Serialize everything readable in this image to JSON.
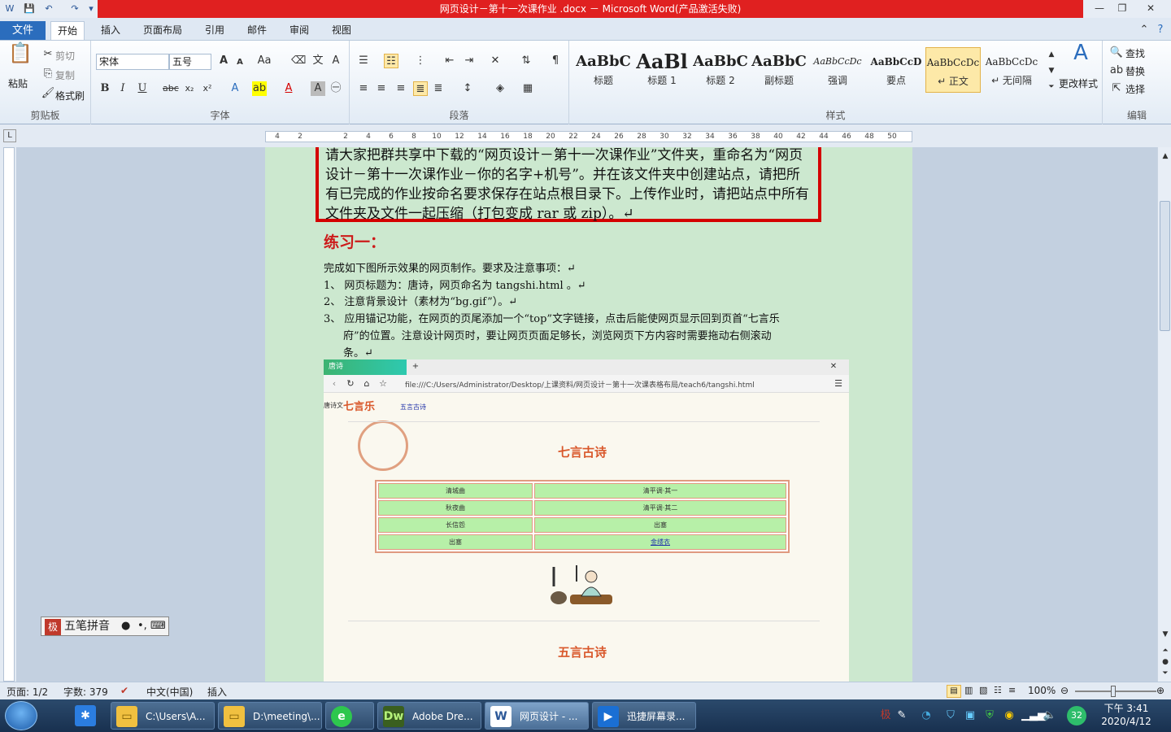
{
  "window": {
    "title": "网页设计－第十一次课作业 .docx － Microsoft Word(产品激活失败)"
  },
  "tabs": {
    "file": "文件",
    "items": [
      "开始",
      "插入",
      "页面布局",
      "引用",
      "邮件",
      "审阅",
      "视图"
    ]
  },
  "ribbon": {
    "clipboard": {
      "label": "剪贴板",
      "paste": "粘贴",
      "cut": "剪切",
      "copy": "复制",
      "format_painter": "格式刷"
    },
    "font": {
      "label": "字体",
      "font_name": "宋体",
      "font_size": "五号"
    },
    "paragraph": {
      "label": "段落"
    },
    "styles": {
      "label": "样式",
      "items": [
        {
          "preview": "AaBbC",
          "name": "标题"
        },
        {
          "preview": "AaBl",
          "name": "标题 1"
        },
        {
          "preview": "AaBbC",
          "name": "标题 2"
        },
        {
          "preview": "AaBbC",
          "name": "副标题"
        },
        {
          "preview": "AaBbCcDc",
          "name": "强调"
        },
        {
          "preview": "AaBbCcD",
          "name": "要点"
        },
        {
          "preview": "AaBbCcDc",
          "name": "↵ 正文"
        },
        {
          "preview": "AaBbCcDc",
          "name": "↵ 无间隔"
        }
      ],
      "change_styles": "更改样式"
    },
    "editing": {
      "label": "编辑",
      "find": "查找",
      "replace": "替换",
      "select": "选择"
    }
  },
  "ruler": {
    "numbers": [
      "4",
      "2",
      "",
      "2",
      "4",
      "6",
      "8",
      "10",
      "12",
      "14",
      "16",
      "18",
      "20",
      "22",
      "24",
      "26",
      "28",
      "30",
      "32",
      "34",
      "36",
      "38",
      "40",
      "42",
      "44",
      "46",
      "48",
      "50"
    ]
  },
  "document": {
    "redbox_text": "请大家把群共享中下载的“网页设计－第十一次课作业”文件夹，重命名为“网页设计－第十一次课作业－你的名字+机号”。并在该文件夹中创建站点，请把所有已完成的作业按命名要求保存在站点根目录下。上传作业时，请把站点中所有文件夹及文件一起压缩（打包变成 rar 或 zip）。↵",
    "heading": "练习一：",
    "intro": "完成如下图所示效果的网页制作。要求及注意事项：↵",
    "items": [
      "1、 网页标题为：唐诗，网页命名为 tangshi.html 。↵",
      "2、 注意背景设计（素材为“bg.gif”）。↵",
      "3、 应用锚记功能，在网页的页尾添加一个“top”文字链接，点击后能使网页显示回到页首“七言乐",
      "府”的位置。注意设计网页时，要让网页页面足够长，浏览网页下方内容时需要拖动右侧滚动",
      "条。↵"
    ],
    "embedded": {
      "tab_title": "唐诗",
      "url": "file:///C:/Users/Administrator/Desktop/上课资料/网页设计－第十一次课表格布局/teach6/tangshi.html",
      "nav_left": "唐诗文",
      "nav_link": "七言乐",
      "nav_right": "五言古诗",
      "title1": "七言古诗",
      "title2": "五言古诗",
      "table": [
        [
          "清城曲",
          "清平调·其一"
        ],
        [
          "秋夜曲",
          "清平调·其二"
        ],
        [
          "长信怨",
          "出塞"
        ],
        [
          "出塞",
          "金缕衣"
        ]
      ]
    }
  },
  "statusbar": {
    "page": "页面: 1/2",
    "words": "字数: 379",
    "language": "中文(中国)",
    "mode": "插入",
    "zoom": "100%"
  },
  "ime": {
    "label": "五笔拼音"
  },
  "taskbar": {
    "items": [
      {
        "label": "C:\\Users\\A...",
        "icon": "folder-icon"
      },
      {
        "label": "D:\\meeting\\...",
        "icon": "folder-icon"
      },
      {
        "label": "",
        "icon": "browser-icon"
      },
      {
        "label": "Adobe Dre...",
        "icon": "dw-icon"
      },
      {
        "label": "网页设计 - ...",
        "icon": "word-icon"
      },
      {
        "label": "迅捷屏幕录...",
        "icon": "recorder-icon"
      }
    ],
    "time": "下午 3:41",
    "date": "2020/4/12",
    "badge": "32"
  }
}
